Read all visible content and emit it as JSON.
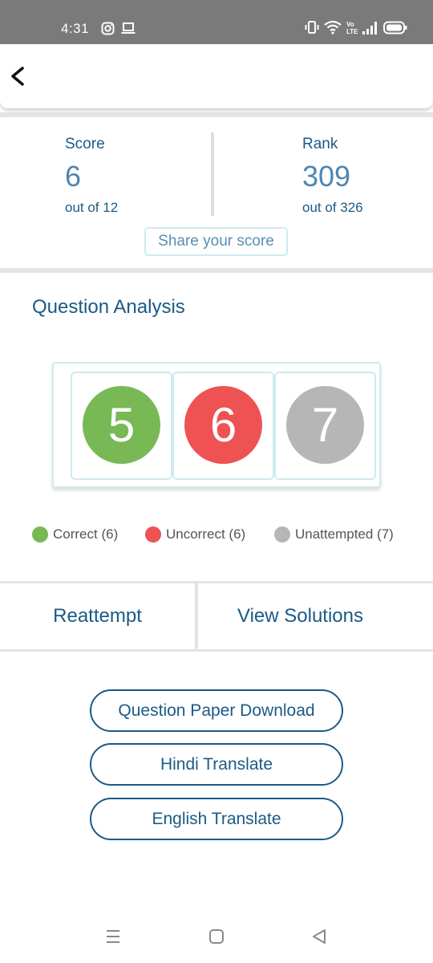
{
  "status_bar": {
    "time": "4:31",
    "left_icons": [
      "instagram-icon",
      "laptop-icon"
    ],
    "right_icons": [
      "vibrate-icon",
      "wifi-icon",
      "volte-icon",
      "signal-icon",
      "battery-icon"
    ]
  },
  "header": {
    "back_icon": "chevron-left-icon"
  },
  "score": {
    "label": "Score",
    "value": "6",
    "sub": "out of 12"
  },
  "rank": {
    "label": "Rank",
    "value": "309",
    "sub": "out of 326"
  },
  "share_label": "Share your score",
  "analysis": {
    "title": "Question Analysis",
    "items": [
      {
        "value": "5",
        "color": "#78b956"
      },
      {
        "value": "6",
        "color": "#ee5253"
      },
      {
        "value": "7",
        "color": "#b6b6b6"
      }
    ]
  },
  "legend": [
    {
      "label": "Correct (6)",
      "color": "#78b956"
    },
    {
      "label": "Uncorrect (6)",
      "color": "#ee5253"
    },
    {
      "label": "Unattempted (7)",
      "color": "#b6b6b6"
    }
  ],
  "actions": {
    "reattempt": "Reattempt",
    "view_solutions": "View Solutions"
  },
  "buttons": {
    "download": "Question Paper Download",
    "hindi": "Hindi Translate",
    "english": "English Translate"
  },
  "nav": {
    "icons": [
      "recent-apps-icon",
      "home-icon",
      "back-icon"
    ]
  },
  "colors": {
    "primary_text": "#1b5a86",
    "value_text": "#4f86b0",
    "card_border": "#cdebf0"
  }
}
